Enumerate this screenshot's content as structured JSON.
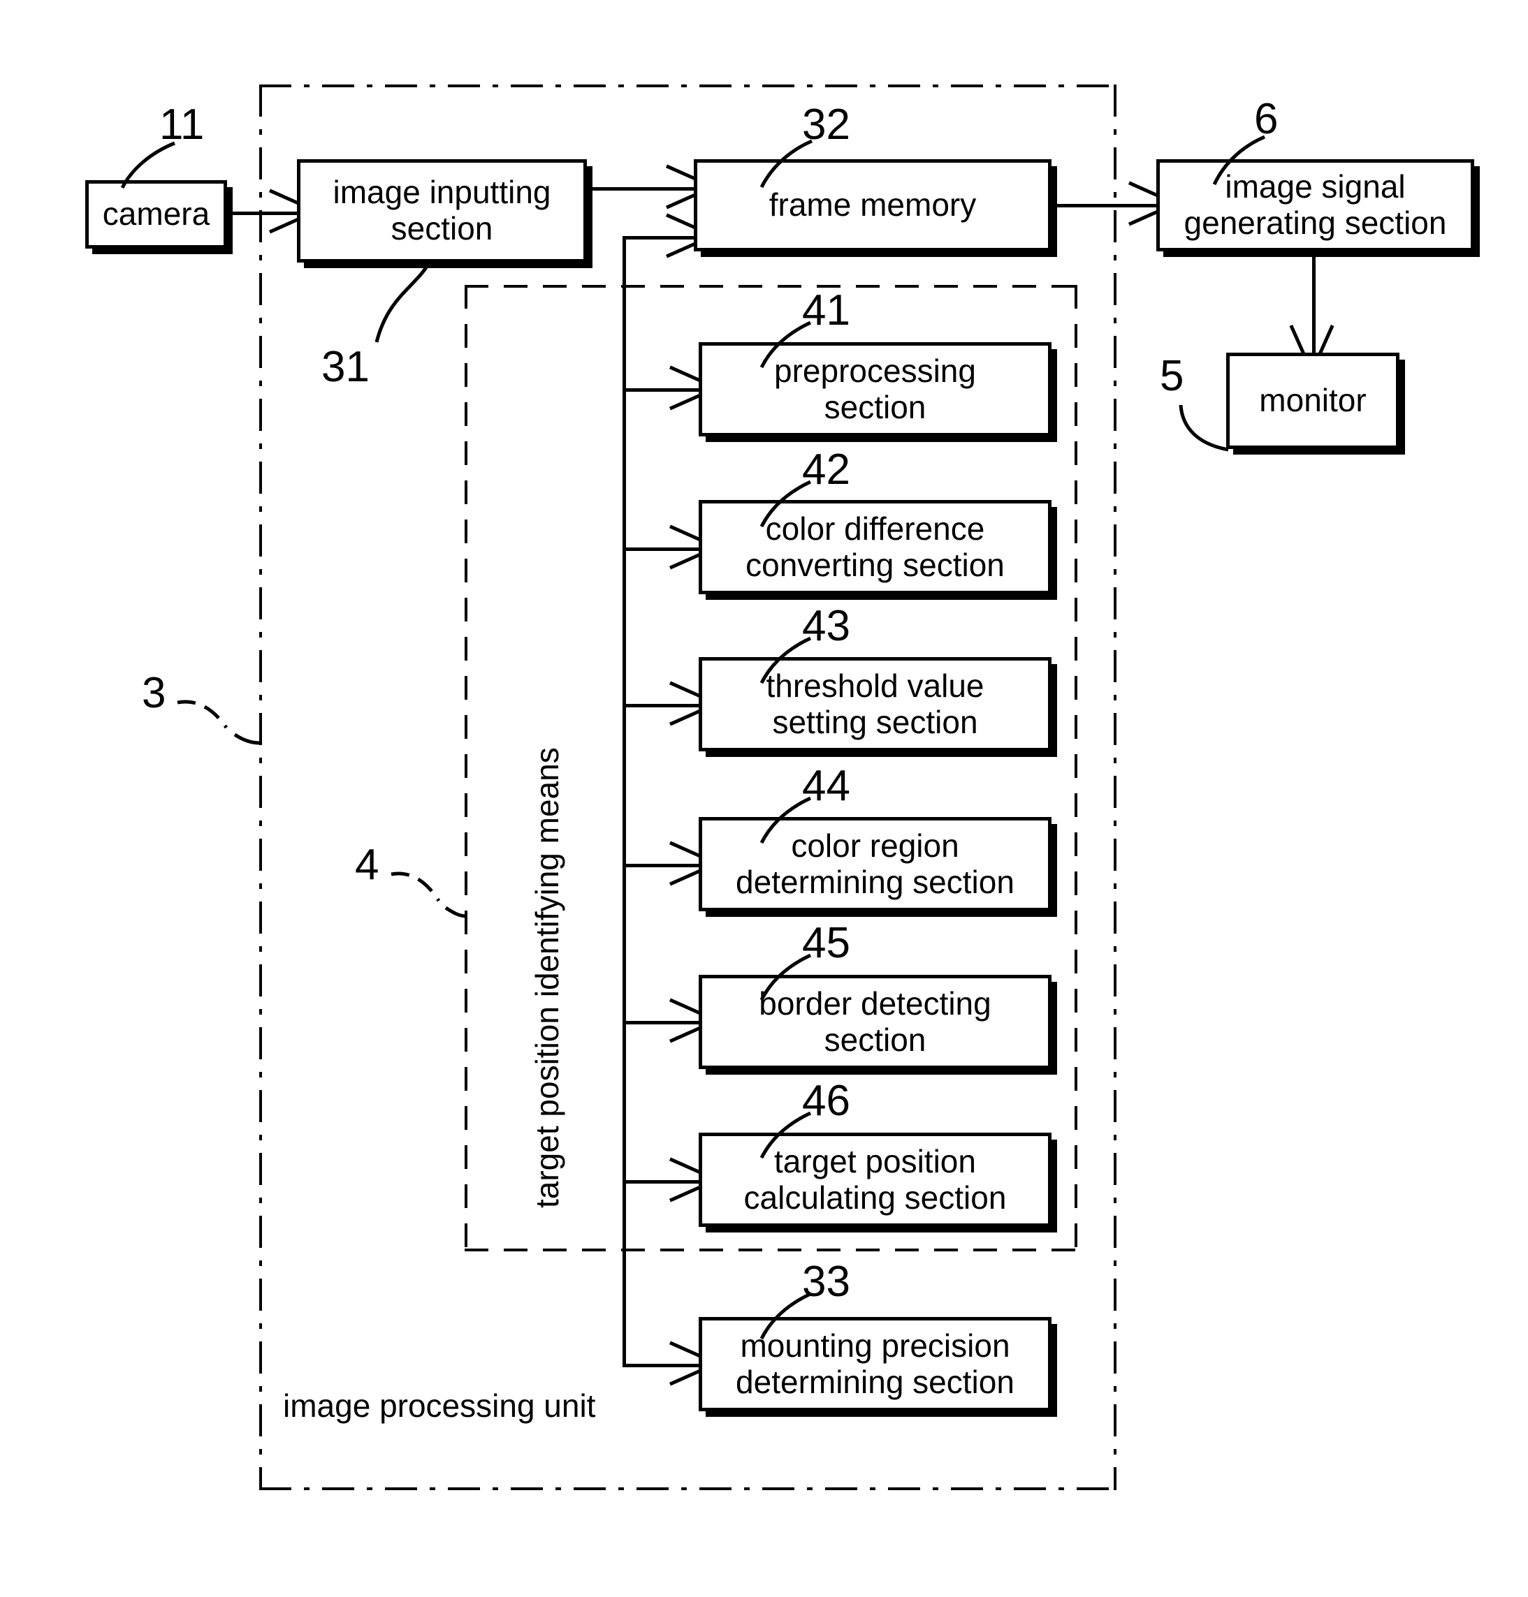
{
  "figure": {
    "type": "block-diagram",
    "enclosures": [
      {
        "id": "3",
        "label": "image processing unit",
        "style": "dash-dot"
      },
      {
        "id": "4",
        "label": "target position identifying means",
        "style": "dashed"
      }
    ]
  },
  "blocks": {
    "camera": {
      "ref": "11",
      "label": "camera"
    },
    "image_inputting": {
      "ref": "31",
      "label_l1": "image inputting",
      "label_l2": "section"
    },
    "frame_memory": {
      "ref": "32",
      "label": "frame memory"
    },
    "image_signal_generating": {
      "ref": "6",
      "label_l1": "image signal",
      "label_l2": "generating section"
    },
    "monitor": {
      "ref": "5",
      "label": "monitor"
    },
    "preprocessing": {
      "ref": "41",
      "label_l1": "preprocessing",
      "label_l2": "section"
    },
    "color_difference_converting": {
      "ref": "42",
      "label_l1": "color difference",
      "label_l2": "converting section"
    },
    "threshold_value_setting": {
      "ref": "43",
      "label_l1": "threshold value",
      "label_l2": "setting section"
    },
    "color_region_determining": {
      "ref": "44",
      "label_l1": "color region",
      "label_l2": "determining section"
    },
    "border_detecting": {
      "ref": "45",
      "label_l1": "border detecting",
      "label_l2": "section"
    },
    "target_position_calculating": {
      "ref": "46",
      "label_l1": "target position",
      "label_l2": "calculating section"
    },
    "mounting_precision_determining": {
      "ref": "33",
      "label_l1": "mounting precision",
      "label_l2": "determining section"
    }
  },
  "enclosure_labels": {
    "image_processing_unit": "image processing unit",
    "target_position_identifying_means": "target position identifying means"
  },
  "reference_numerals": {
    "unit": "3",
    "means": "4",
    "camera": "11",
    "image_inputting": "31",
    "frame_memory": "32",
    "mounting_precision": "33",
    "preprocessing": "41",
    "color_difference": "42",
    "threshold_value": "43",
    "color_region": "44",
    "border_detecting": "45",
    "target_position": "46",
    "image_signal_generating": "6",
    "monitor": "5"
  },
  "colors": {
    "ink": "#000000",
    "paper": "#ffffff"
  }
}
